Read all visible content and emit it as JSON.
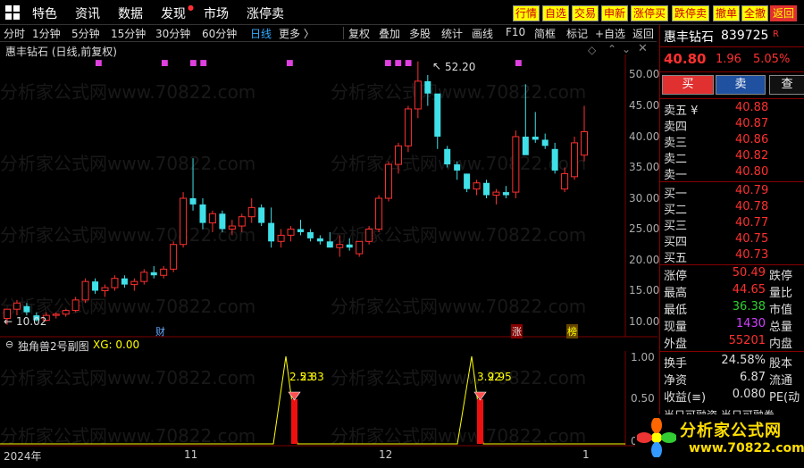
{
  "menu": {
    "items": [
      "特色",
      "资讯",
      "数据",
      "发现",
      "市场",
      "涨停卖"
    ],
    "quick": [
      "行情",
      "自选",
      "交易",
      "申新",
      "涨停买",
      "跌停卖",
      "撤单",
      "全撤",
      "返回"
    ]
  },
  "toolbar": {
    "periods": [
      "分时",
      "1分钟",
      "5分钟",
      "15分钟",
      "30分钟",
      "60分钟",
      "日线",
      "更多 〉"
    ],
    "active": "日线",
    "tools": [
      "复权",
      "叠加",
      "多股",
      "统计",
      "画线",
      "F10",
      "简框",
      "标记",
      "+自选",
      "返回"
    ]
  },
  "chart": {
    "title": "惠丰钻石 (日线,前复权)",
    "high_label": "52.20",
    "low_label": "10.02",
    "badges": [
      "财",
      "涨",
      "榜"
    ],
    "indicator": {
      "title": "独角兽2号副图",
      "xg": "XG: 0.00",
      "labels": [
        "2.53",
        "2.83",
        "3.92",
        "2.95"
      ]
    },
    "yticks": [
      "50.00",
      "45.00",
      "40.00",
      "35.00",
      "30.00",
      "25.00",
      "20.00",
      "15.00",
      "10.00"
    ],
    "ind_yticks": [
      "1.00",
      "0.50",
      "0.00"
    ],
    "xticks": [
      "2024年",
      "11",
      "12",
      "1"
    ],
    "watermark": "分析家公式网www.70822.com"
  },
  "chart_data": {
    "type": "candlestick",
    "ylim": [
      8,
      55
    ],
    "candles": [
      [
        10.5,
        12.0,
        9.5,
        12.0
      ],
      [
        12.0,
        13.5,
        11.0,
        13.0
      ],
      [
        12.5,
        13.0,
        11.0,
        11.5
      ],
      [
        11.0,
        11.5,
        10.0,
        10.2
      ],
      [
        10.2,
        11.5,
        10.02,
        11.0
      ],
      [
        11.0,
        11.5,
        10.5,
        11.2
      ],
      [
        11.2,
        12.0,
        10.8,
        11.8
      ],
      [
        11.8,
        14.0,
        11.5,
        13.5
      ],
      [
        13.5,
        17.0,
        13.0,
        16.5
      ],
      [
        16.5,
        17.0,
        14.5,
        15.0
      ],
      [
        15.0,
        16.0,
        14.0,
        15.5
      ],
      [
        15.5,
        17.5,
        15.0,
        17.0
      ],
      [
        17.0,
        17.5,
        15.5,
        16.0
      ],
      [
        16.0,
        17.0,
        15.0,
        16.5
      ],
      [
        16.5,
        18.5,
        16.0,
        18.0
      ],
      [
        18.0,
        19.0,
        17.0,
        17.5
      ],
      [
        17.5,
        19.0,
        17.0,
        18.5
      ],
      [
        18.5,
        23.0,
        18.0,
        22.5
      ],
      [
        22.5,
        31.0,
        22.0,
        30.0
      ],
      [
        30.0,
        36.5,
        28.0,
        29.0
      ],
      [
        29.0,
        30.0,
        25.0,
        26.0
      ],
      [
        26.0,
        28.0,
        24.5,
        27.5
      ],
      [
        27.5,
        28.0,
        24.5,
        25.0
      ],
      [
        25.0,
        26.5,
        24.0,
        25.5
      ],
      [
        25.5,
        27.5,
        24.5,
        27.0
      ],
      [
        27.0,
        30.0,
        26.0,
        28.5
      ],
      [
        28.5,
        29.0,
        25.5,
        26.0
      ],
      [
        26.0,
        28.5,
        22.0,
        23.0
      ],
      [
        23.0,
        25.0,
        22.0,
        24.0
      ],
      [
        24.0,
        25.5,
        23.0,
        25.0
      ],
      [
        25.0,
        26.5,
        24.0,
        24.5
      ],
      [
        24.5,
        25.0,
        23.0,
        23.5
      ],
      [
        23.5,
        24.0,
        22.5,
        23.0
      ],
      [
        23.0,
        24.5,
        22.0,
        22.0
      ],
      [
        22.0,
        24.0,
        20.5,
        22.5
      ],
      [
        22.5,
        23.5,
        21.5,
        22.0
      ],
      [
        21.0,
        23.0,
        20.5,
        23.0
      ],
      [
        23.0,
        25.5,
        22.5,
        25.0
      ],
      [
        25.0,
        30.5,
        24.5,
        30.0
      ],
      [
        30.0,
        36.0,
        29.5,
        35.5
      ],
      [
        35.5,
        39.0,
        34.0,
        38.5
      ],
      [
        38.5,
        45.0,
        37.5,
        44.5
      ],
      [
        44.5,
        52.2,
        43.0,
        49.0
      ],
      [
        49.0,
        50.0,
        45.0,
        47.0
      ],
      [
        47.0,
        46.0,
        38.0,
        40.0
      ],
      [
        38.0,
        38.5,
        35.0,
        35.5
      ],
      [
        35.5,
        36.0,
        33.0,
        34.5
      ],
      [
        34.0,
        34.0,
        31.0,
        31.5
      ],
      [
        31.5,
        33.0,
        30.5,
        32.5
      ],
      [
        32.5,
        33.0,
        30.0,
        30.5
      ],
      [
        30.5,
        31.5,
        29.0,
        31.0
      ],
      [
        31.0,
        32.0,
        30.0,
        30.5
      ],
      [
        31.0,
        41.0,
        30.0,
        40.0
      ],
      [
        40.0,
        48.5,
        38.5,
        37.0
      ],
      [
        40.0,
        44.0,
        39.0,
        39.5
      ],
      [
        39.5,
        40.5,
        38.0,
        38.5
      ],
      [
        38.0,
        39.0,
        34.0,
        34.5
      ],
      [
        31.5,
        35.0,
        31.0,
        34.0
      ],
      [
        33.5,
        40.0,
        33.0,
        39.0
      ],
      [
        37.0,
        45.0,
        36.0,
        40.8
      ]
    ]
  },
  "quote": {
    "name": "惠丰钻石",
    "code": "839725",
    "tag": "R",
    "price": "40.80",
    "change": "1.96",
    "pct": "5.05%",
    "buy": "买",
    "sell": "卖",
    "more": "查"
  },
  "orderbook": {
    "asks": [
      {
        "l": "卖五 ¥",
        "p": "40.88"
      },
      {
        "l": "卖四",
        "p": "40.87"
      },
      {
        "l": "卖三",
        "p": "40.86"
      },
      {
        "l": "卖二",
        "p": "40.82"
      },
      {
        "l": "卖一",
        "p": "40.80"
      }
    ],
    "bids": [
      {
        "l": "买一",
        "p": "40.79"
      },
      {
        "l": "买二",
        "p": "40.78"
      },
      {
        "l": "买三",
        "p": "40.77"
      },
      {
        "l": "买四",
        "p": "40.75"
      },
      {
        "l": "买五",
        "p": "40.73"
      }
    ]
  },
  "stats": [
    {
      "l": "涨停",
      "v": "50.49",
      "c": "#ff3030",
      "l2": "跌停"
    },
    {
      "l": "最高",
      "v": "44.65",
      "c": "#ff3030",
      "l2": "量比"
    },
    {
      "l": "最低",
      "v": "36.38",
      "c": "#2fd02f",
      "l2": "市值"
    },
    {
      "l": "现量",
      "v": "1430",
      "c": "#d040ff",
      "l2": "总量"
    },
    {
      "l": "外盘",
      "v": "55201",
      "c": "#ff3030",
      "l2": "内盘"
    },
    {
      "l": "换手",
      "v": "24.58%",
      "c": "#ddd",
      "l2": "股本"
    },
    {
      "l": "净资",
      "v": "6.87",
      "c": "#ddd",
      "l2": "流通"
    },
    {
      "l": "收益(≡)",
      "v": "0.080",
      "c": "#ddd",
      "l2": "PE(动"
    }
  ],
  "footer": {
    "bottom_text": "当日可融资 当日可融券",
    "brand": "分析家公式网",
    "url": "www.70822.com"
  },
  "colors": {
    "up": "#ff3030",
    "down": "#40e0e8",
    "axis": "#800000",
    "ind": "#ffff00"
  }
}
